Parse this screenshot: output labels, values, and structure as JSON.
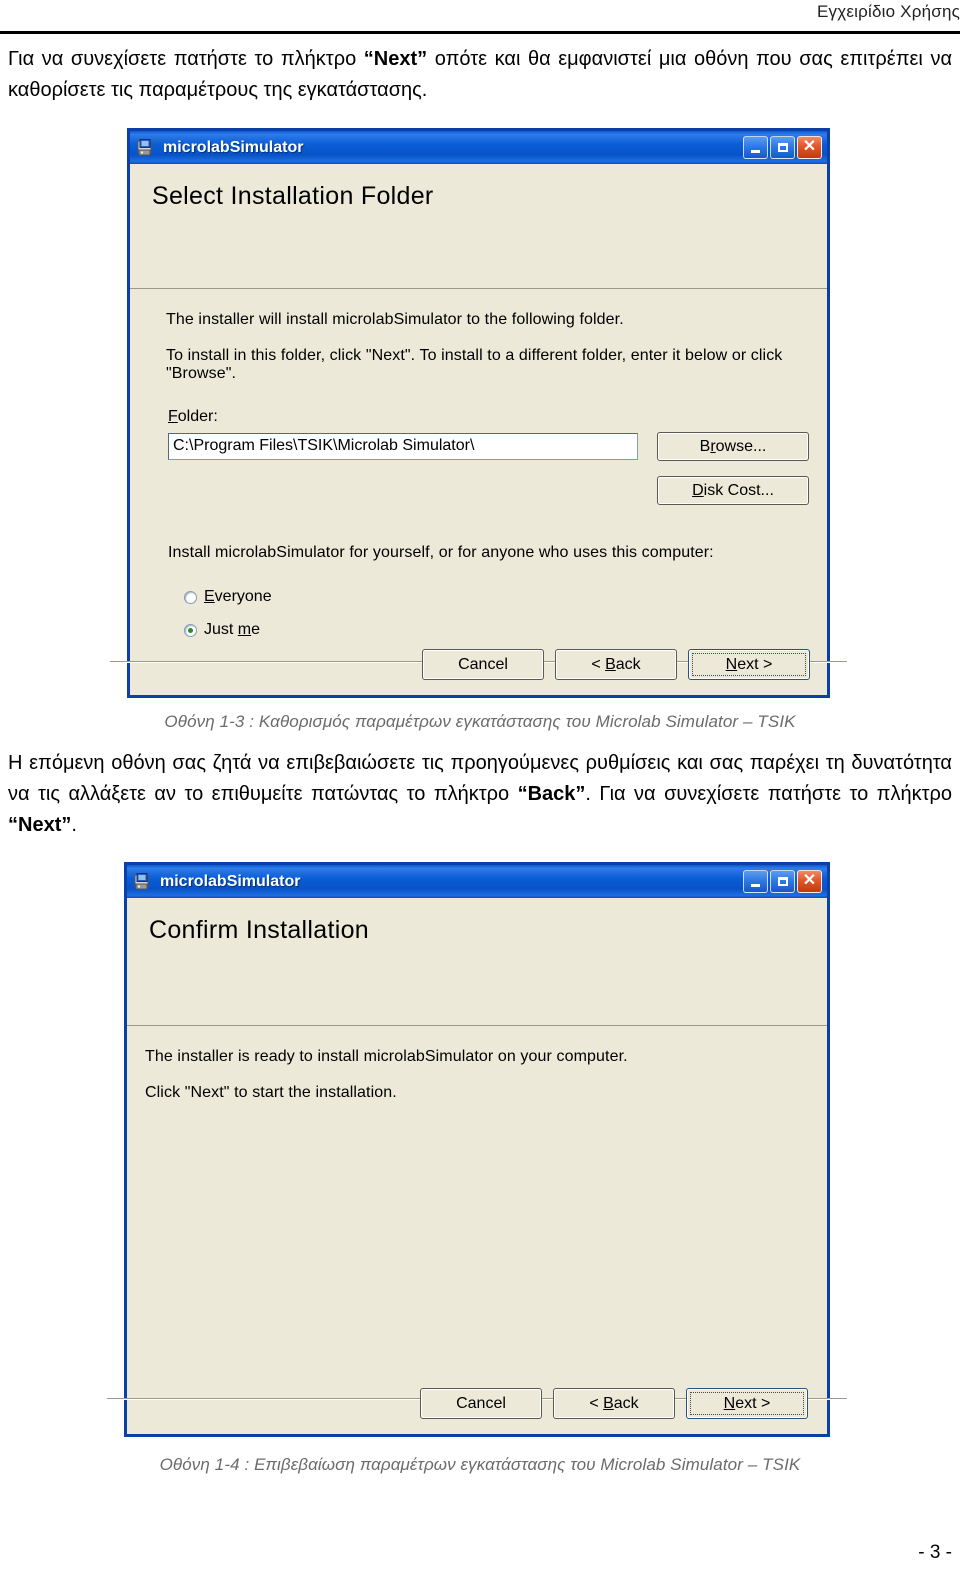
{
  "page": {
    "header_right": "Εγχειρίδιο Χρήσης",
    "footer": "- 3 -"
  },
  "paragraphs": {
    "intro_part1": "Για να συνεχίσετε πατήστε το πλήκτρο ",
    "intro_next": "“Next”",
    "intro_part2": " οπότε και θα εμφανιστεί μια οθόνη που σας επιτρέπει να καθορίσετε τις παραμέτρους της εγκατάστασης.",
    "middle_part1": "Η επόμενη οθόνη σας ζητά να επιβεβαιώσετε τις προηγούμενες ρυθμίσεις και σας παρέχει τη δυνατότητα να τις αλλάξετε αν το επιθυμείτε πατώντας το πλήκτρο ",
    "middle_back": "“Back”",
    "middle_part2": ". Για να συνεχίσετε πατήστε το πλήκτρο ",
    "middle_next": "“Next”",
    "middle_part3": "."
  },
  "captions": {
    "figure_1_3": "Οθόνη 1-3 : Καθορισμός παραμέτρων εγκατάστασης του Microlab Simulator – TSIK",
    "figure_1_4": "Οθόνη 1-4 : Επιβεβαίωση παραμέτρων εγκατάστασης του Microlab Simulator – TSIK"
  },
  "colors": {
    "title_bar_blue": "#0a5ad4",
    "window_border": "#0a40a8",
    "dialog_face": "#ece9d8",
    "close_button_red": "#e2562a",
    "caption_gray": "#6b6b6b",
    "radio_dot_green": "#2d8a2d"
  },
  "dialog_select_folder": {
    "title": "microlabSimulator",
    "banner_title": "Select Installation Folder",
    "line1": "The installer will install microlabSimulator to the following folder.",
    "line2": "To install in this folder, click \"Next\". To install to a different folder, enter it below or click \"Browse\".",
    "folder_label": "Folder:",
    "folder_label_mnemonic": "F",
    "folder_label_rest": "older:",
    "folder_value": "C:\\Program Files\\TSIK\\Microlab Simulator\\",
    "browse_button": "Browse...",
    "browse_mnemonic_pre": "B",
    "browse_mnemonic": "r",
    "browse_mnemonic_post": "owse...",
    "disk_cost_button": "Disk Cost...",
    "disk_cost_mnemonic": "D",
    "disk_cost_rest": "isk Cost...",
    "scope_label": "Install microlabSimulator for yourself, or for anyone who uses this computer:",
    "radio_everyone": "Everyone",
    "radio_everyone_mnemonic": "E",
    "radio_everyone_rest": "veryone",
    "radio_just_me_pre": "Just ",
    "radio_just_me_mnemonic": "m",
    "radio_just_me_post": "e",
    "selected_option": "Just me",
    "cancel_button": "Cancel",
    "back_button_pre": "< ",
    "back_button_mnemonic": "B",
    "back_button_post": "ack",
    "next_button_mnemonic": "N",
    "next_button_post": "ext >",
    "minimize_icon": "minimize-icon",
    "maximize_icon": "maximize-icon",
    "close_icon": "close-icon",
    "app_icon": "installer-package-icon"
  },
  "dialog_confirm_installation": {
    "title": "microlabSimulator",
    "banner_title": "Confirm Installation",
    "line1": "The installer is ready to install microlabSimulator on your computer.",
    "line2": "Click \"Next\" to start the installation.",
    "cancel_button": "Cancel",
    "back_button_pre": "< ",
    "back_button_mnemonic": "B",
    "back_button_post": "ack",
    "next_button_mnemonic": "N",
    "next_button_post": "ext >",
    "minimize_icon": "minimize-icon",
    "maximize_icon": "maximize-icon",
    "close_icon": "close-icon",
    "app_icon": "installer-package-icon"
  }
}
